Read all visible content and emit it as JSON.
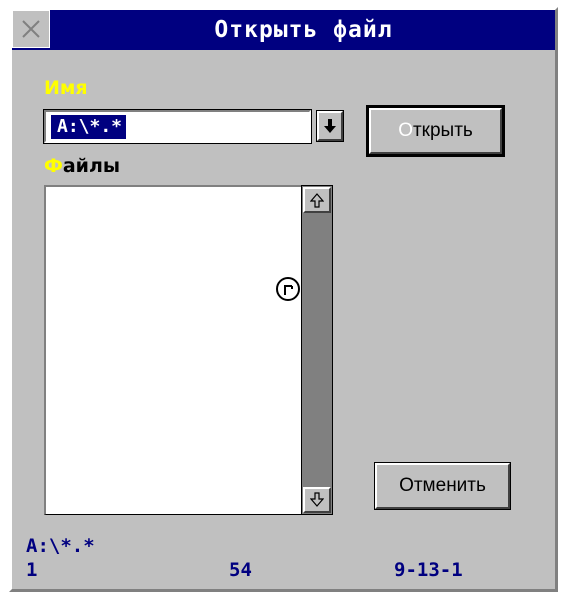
{
  "window": {
    "title": "Открыть файл",
    "close_icon": "close-icon",
    "colors": {
      "title_bg": "#000080",
      "title_fg": "#ffffff",
      "face": "#c0c0c0",
      "hotkey_label": "#ffff00",
      "status_text": "#000080"
    }
  },
  "name_field": {
    "label_hot": "И",
    "label_rest": "мя",
    "value": "A:\\*.*",
    "dropdown_icon": "arrow-down-icon"
  },
  "files": {
    "label_hot": "Ф",
    "label_rest": "айлы",
    "items": [],
    "scroll_up_icon": "arrow-up-icon",
    "scroll_down_icon": "arrow-down-icon"
  },
  "buttons": {
    "open_hot": "О",
    "open_rest": "ткрыть",
    "cancel": "Отменить"
  },
  "status": {
    "path": "A:\\*.*",
    "left": "1",
    "middle": "54",
    "right": "9-13-1"
  }
}
